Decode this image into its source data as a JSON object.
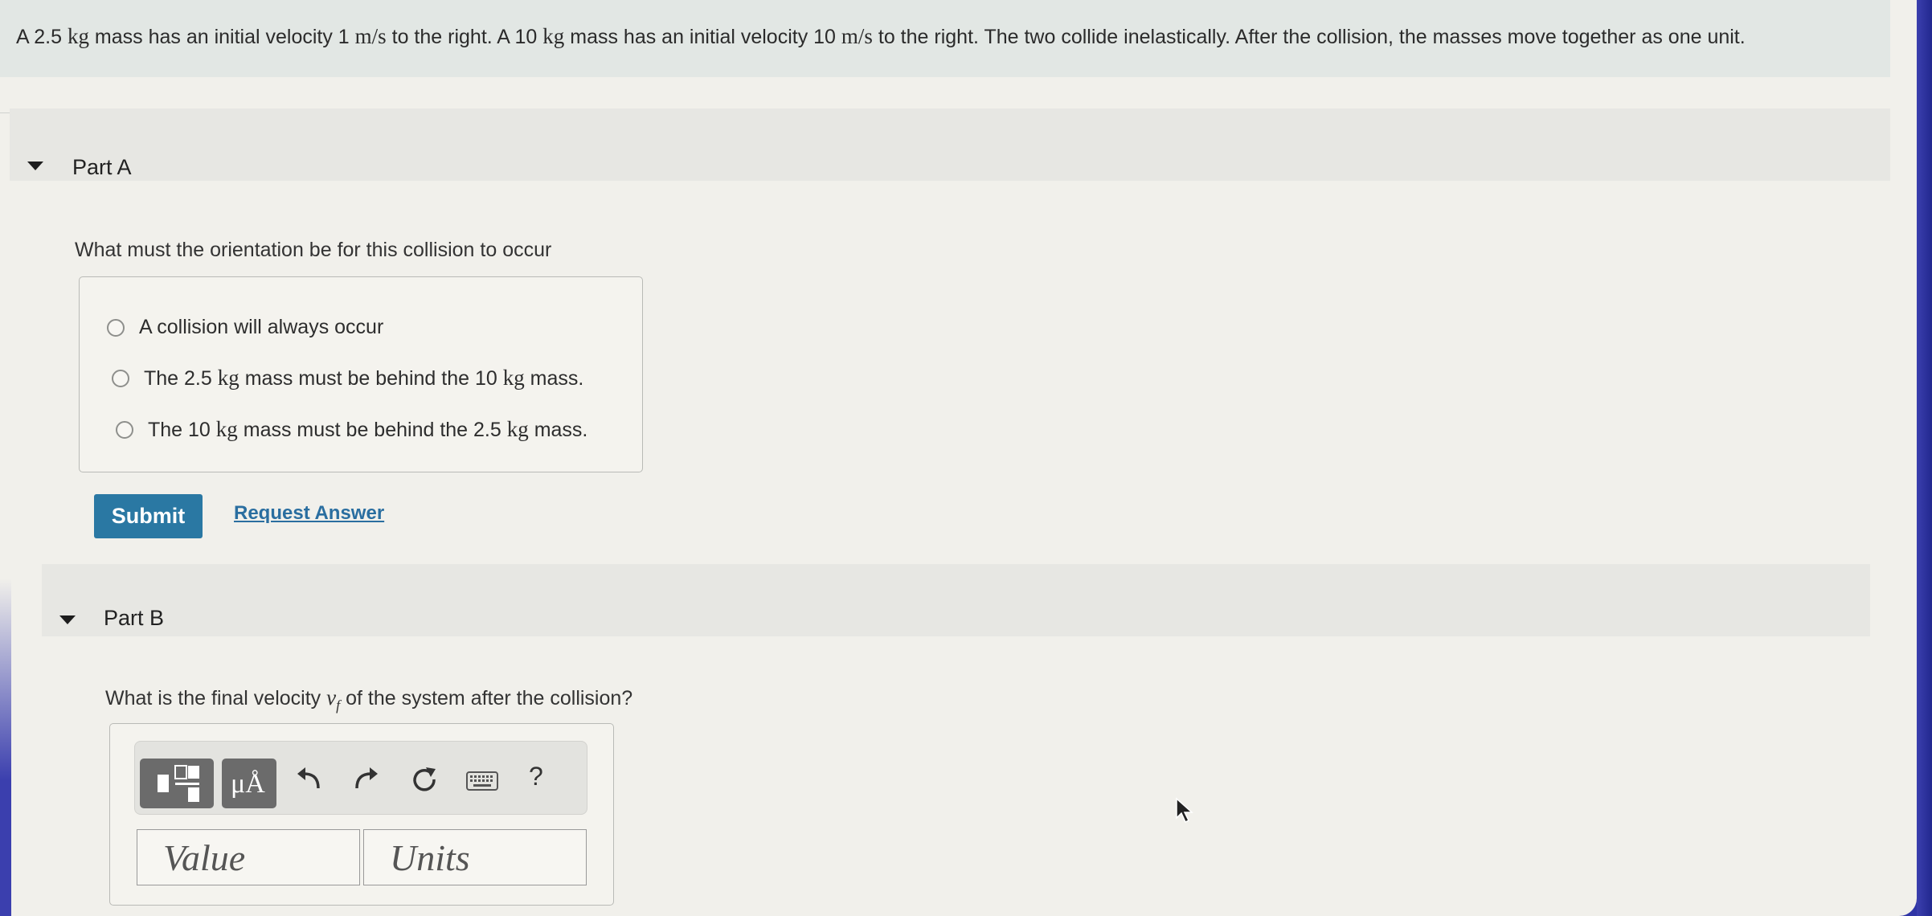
{
  "problem": {
    "t1": "A 2.5",
    "u_kg1": "kg",
    "t2": "mass has an initial velocity 1",
    "u_ms1": "m/s",
    "t3": "to the right.  A 10",
    "u_kg2": "kg",
    "t4": "mass has an initial velocity 10",
    "u_ms2": "m/s",
    "t5": "to the right.  The two collide inelastically.  After the collision, the masses move together as one unit."
  },
  "part_a": {
    "title": "Part A",
    "question": "What must the orientation be for this collision to occur",
    "choices": [
      {
        "text": "A collision will always occur"
      },
      {
        "pre": "The 2.5",
        "u1": "kg",
        "mid": "mass must be behind the 10",
        "u2": "kg",
        "post": "mass."
      },
      {
        "pre": "The 10",
        "u1": "kg",
        "mid": "mass must be behind the 2.5",
        "u2": "kg",
        "post": "mass."
      }
    ],
    "submit_label": "Submit",
    "request_label": "Request Answer"
  },
  "part_b": {
    "title": "Part B",
    "question_pre": "What is the final velocity",
    "var": "v",
    "var_sub": "f",
    "question_post": "of the system after the collision?",
    "toolbar": {
      "units_label": "μÅ",
      "help_label": "?"
    },
    "value_placeholder": "Value",
    "units_placeholder": "Units"
  },
  "icons": {
    "collapse_a": "caret-down-icon",
    "collapse_b": "caret-down-icon",
    "templates": "fraction-template-icon",
    "undo": "undo-icon",
    "redo": "redo-icon",
    "reset": "reset-icon",
    "keyboard": "keyboard-icon"
  },
  "colors": {
    "accent": "#2a78a3",
    "link": "#2a6ea0",
    "problem_bar": "#e2e7e4"
  }
}
